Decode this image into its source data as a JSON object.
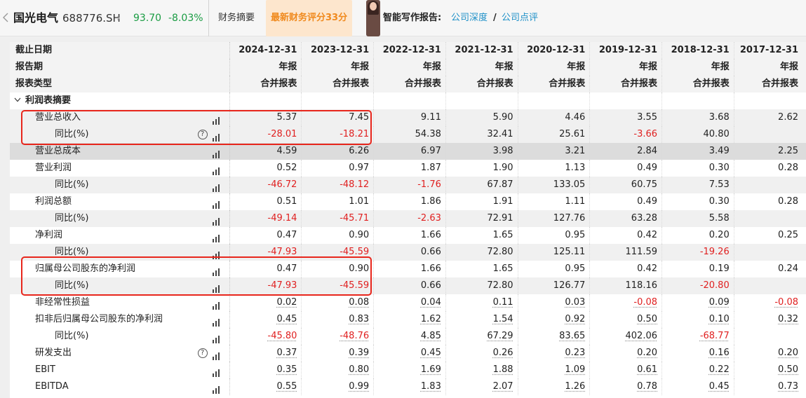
{
  "header": {
    "stock_name": "国光电气",
    "stock_code": "688776.SH",
    "price": "93.70",
    "change": "-8.03%",
    "tab_summary": "财务摘要",
    "score_badge": "最新财务评分33分",
    "report_label": "智能写作报告:",
    "link_depth": "公司深度",
    "slash": "/",
    "link_review": "公司点评",
    "icons": [
      "chevron-left-icon",
      "chevron-right-icon",
      "avatar"
    ]
  },
  "table": {
    "header_rows": [
      {
        "label": "截止日期",
        "values": [
          "2024-12-31",
          "2023-12-31",
          "2022-12-31",
          "2021-12-31",
          "2020-12-31",
          "2019-12-31",
          "2018-12-31",
          "2017-12-31"
        ]
      },
      {
        "label": "报告期",
        "values": [
          "年报",
          "年报",
          "年报",
          "年报",
          "年报",
          "年报",
          "年报",
          "年报"
        ]
      },
      {
        "label": "报表类型",
        "values": [
          "合并报表",
          "合并报表",
          "合并报表",
          "合并报表",
          "合并报表",
          "合并报表",
          "合并报表",
          "合并报表"
        ]
      }
    ],
    "section_label": "利润表摘要",
    "rows": [
      {
        "label": "营业总收入",
        "values": [
          "5.37",
          "7.45",
          "9.11",
          "5.90",
          "4.46",
          "3.55",
          "3.68",
          "2.62"
        ]
      },
      {
        "label": "同比(%)",
        "values": [
          "-28.01",
          "-18.21",
          "54.38",
          "32.41",
          "25.61",
          "-3.66",
          "40.80",
          ""
        ]
      },
      {
        "label": "营业总成本",
        "values": [
          "4.59",
          "6.26",
          "6.97",
          "3.98",
          "3.21",
          "2.84",
          "3.49",
          "2.25"
        ]
      },
      {
        "label": "营业利润",
        "values": [
          "0.52",
          "0.97",
          "1.87",
          "1.90",
          "1.13",
          "0.49",
          "0.30",
          "0.28"
        ]
      },
      {
        "label": "同比(%)",
        "values": [
          "-46.72",
          "-48.12",
          "-1.76",
          "67.87",
          "133.05",
          "60.75",
          "7.53",
          ""
        ]
      },
      {
        "label": "利润总额",
        "values": [
          "0.51",
          "1.01",
          "1.86",
          "1.91",
          "1.11",
          "0.49",
          "0.30",
          "0.28"
        ]
      },
      {
        "label": "同比(%)",
        "values": [
          "-49.14",
          "-45.71",
          "-2.63",
          "72.91",
          "127.76",
          "63.28",
          "5.58",
          ""
        ]
      },
      {
        "label": "净利润",
        "values": [
          "0.47",
          "0.90",
          "1.66",
          "1.65",
          "0.95",
          "0.42",
          "0.20",
          "0.25"
        ]
      },
      {
        "label": "同比(%)",
        "values": [
          "-47.93",
          "-45.59",
          "0.66",
          "72.80",
          "125.11",
          "111.59",
          "-19.26",
          ""
        ]
      },
      {
        "label": "归属母公司股东的净利润",
        "values": [
          "0.47",
          "0.90",
          "1.66",
          "1.65",
          "0.95",
          "0.42",
          "0.19",
          "0.24"
        ]
      },
      {
        "label": "同比(%)",
        "values": [
          "-47.93",
          "-45.59",
          "0.66",
          "72.80",
          "126.77",
          "118.16",
          "-20.80",
          ""
        ]
      },
      {
        "label": "非经常性损益",
        "values": [
          "0.02",
          "0.08",
          "0.04",
          "0.11",
          "0.03",
          "-0.08",
          "0.09",
          "-0.08"
        ]
      },
      {
        "label": "扣非后归属母公司股东的净利润",
        "values": [
          "0.45",
          "0.83",
          "1.62",
          "1.54",
          "0.92",
          "0.50",
          "0.10",
          "0.32"
        ]
      },
      {
        "label": "同比(%)",
        "values": [
          "-45.80",
          "-48.76",
          "4.85",
          "67.29",
          "83.65",
          "402.06",
          "-68.77",
          ""
        ]
      },
      {
        "label": "研发支出",
        "values": [
          "0.37",
          "0.39",
          "0.45",
          "0.26",
          "0.23",
          "0.20",
          "0.16",
          "0.20"
        ]
      },
      {
        "label": "EBIT",
        "values": [
          "0.35",
          "0.80",
          "1.69",
          "1.88",
          "1.09",
          "0.61",
          "0.22",
          "0.50"
        ]
      },
      {
        "label": "EBITDA",
        "values": [
          "0.55",
          "0.99",
          "1.83",
          "2.07",
          "1.26",
          "0.78",
          "0.45",
          "0.73"
        ]
      }
    ]
  },
  "colors": {
    "negative": "#e02020",
    "positive": "#1a9c43",
    "link": "#1e90c8",
    "badge_text": "#f08a1e",
    "badge_bg": "#fde6cd",
    "highlight": "#e8261c"
  }
}
